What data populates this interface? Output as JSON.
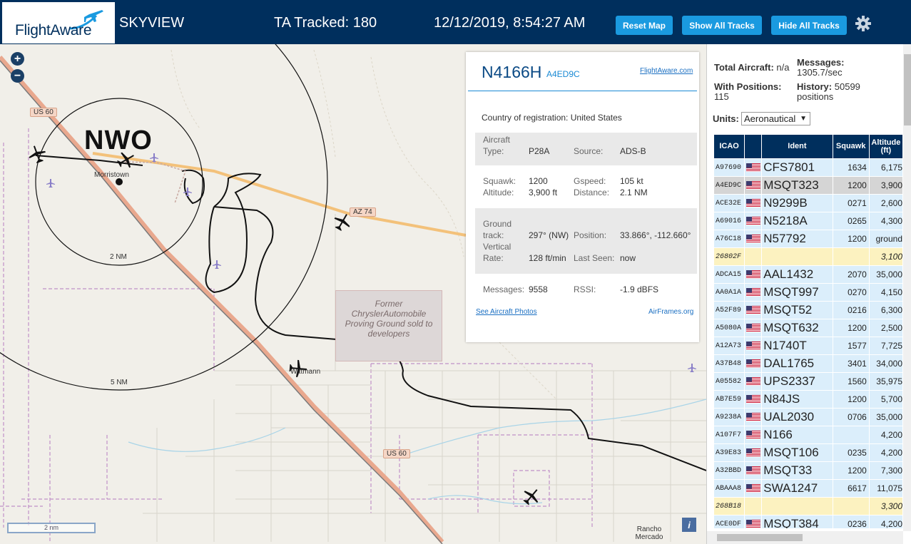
{
  "header": {
    "logo_text": "FlightAware",
    "app_name": "SKYVIEW",
    "tracked": "TA Tracked: 180",
    "datetime": "12/12/2019, 8:54:27 AM",
    "reset_map": "Reset Map",
    "show_all_tracks": "Show All Tracks",
    "hide_all_tracks": "Hide All Tracks"
  },
  "map": {
    "zoom_in": "+",
    "zoom_out": "−",
    "airport_code": "NWO",
    "labels": {
      "morristown": "Morristown",
      "wittmann": "Wittmann",
      "range_2nm": "2 NM",
      "range_5nm": "5 NM",
      "rancho": "Rancho Mercado"
    },
    "roads": {
      "us60_a": "US 60",
      "az74": "AZ 74",
      "us60_b": "US 60"
    },
    "proving_ground": "Former ChryslerAutomobile Proving Ground sold to developers",
    "scale_label": "2 nm",
    "info": "i"
  },
  "popup": {
    "callsign": "N4166H",
    "hex": "A4ED9C",
    "fa_link": "FlightAware.com",
    "country_label": "Country of registration:",
    "country": "United States",
    "aircraft_type_label": "Aircraft Type:",
    "aircraft_type": "P28A",
    "source_label": "Source:",
    "source": "ADS-B",
    "squawk_label": "Squawk:",
    "squawk": "1200",
    "gspeed_label": "Gspeed:",
    "gspeed": "105 kt",
    "altitude_label": "Altitude:",
    "altitude": "3,900 ft",
    "distance_label": "Distance:",
    "distance": "2.1 NM",
    "ground_track_label": "Ground track:",
    "ground_track": "297° (NW)",
    "position_label": "Position:",
    "position": "33.866°, -112.660°",
    "vertical_rate_label": "Vertical Rate:",
    "vertical_rate": "128 ft/min",
    "last_seen_label": "Last Seen:",
    "last_seen": "now",
    "messages_label": "Messages:",
    "messages": "9558",
    "rssi_label": "RSSI:",
    "rssi": "-1.9 dBFS",
    "photos_link": "See Aircraft Photos",
    "airframes_link": "AirFrames.org"
  },
  "panel": {
    "total_aircraft_label": "Total Aircraft:",
    "total_aircraft": "n/a",
    "messages_label": "Messages:",
    "messages": "1305.7/sec",
    "with_positions_label": "With Positions:",
    "with_positions": "115",
    "history_label": "History:",
    "history": "50599 positions",
    "units_label": "Units:",
    "units_value": "Aeronautical",
    "columns": [
      "ICAO",
      "",
      "Ident",
      "Squawk",
      "Altitude (ft)"
    ],
    "rows": [
      {
        "icao": "A97690",
        "ident": "CFS7801",
        "squawk": "1634",
        "alt": "6,175",
        "state": ""
      },
      {
        "icao": "A4ED9C",
        "ident": "MSQT323",
        "squawk": "1200",
        "alt": "3,900",
        "state": "sel"
      },
      {
        "icao": "ACE32E",
        "ident": "N9299B",
        "squawk": "0271",
        "alt": "2,600",
        "state": ""
      },
      {
        "icao": "A69016",
        "ident": "N5218A",
        "squawk": "0265",
        "alt": "4,300",
        "state": ""
      },
      {
        "icao": "A76C18",
        "ident": "N57792",
        "squawk": "1200",
        "alt": "ground",
        "state": ""
      },
      {
        "icao": "26802F",
        "ident": "",
        "squawk": "",
        "alt": "3,100",
        "state": "nopos"
      },
      {
        "icao": "ADCA15",
        "ident": "AAL1432",
        "squawk": "2070",
        "alt": "35,000",
        "state": ""
      },
      {
        "icao": "AA0A1A",
        "ident": "MSQT997",
        "squawk": "0270",
        "alt": "4,150",
        "state": ""
      },
      {
        "icao": "A52F89",
        "ident": "MSQT52",
        "squawk": "0216",
        "alt": "6,300",
        "state": ""
      },
      {
        "icao": "A5080A",
        "ident": "MSQT632",
        "squawk": "1200",
        "alt": "2,500",
        "state": ""
      },
      {
        "icao": "A12A73",
        "ident": "N1740T",
        "squawk": "1577",
        "alt": "7,725",
        "state": ""
      },
      {
        "icao": "A37B48",
        "ident": "DAL1765",
        "squawk": "3401",
        "alt": "34,000",
        "state": ""
      },
      {
        "icao": "A05582",
        "ident": "UPS2337",
        "squawk": "1560",
        "alt": "35,975",
        "state": ""
      },
      {
        "icao": "AB7E59",
        "ident": "N84JS",
        "squawk": "1200",
        "alt": "5,700",
        "state": ""
      },
      {
        "icao": "A9238A",
        "ident": "UAL2030",
        "squawk": "0706",
        "alt": "35,000",
        "state": ""
      },
      {
        "icao": "A107F7",
        "ident": "N166",
        "squawk": "",
        "alt": "4,200",
        "state": ""
      },
      {
        "icao": "A39E83",
        "ident": "MSQT106",
        "squawk": "0235",
        "alt": "4,200",
        "state": ""
      },
      {
        "icao": "A32BBD",
        "ident": "MSQT33",
        "squawk": "1200",
        "alt": "7,300",
        "state": ""
      },
      {
        "icao": "ABAAA8",
        "ident": "SWA1247",
        "squawk": "6617",
        "alt": "11,075",
        "state": ""
      },
      {
        "icao": "268B18",
        "ident": "",
        "squawk": "",
        "alt": "3,300",
        "state": "nopos"
      },
      {
        "icao": "ACE0DF",
        "ident": "MSQT384",
        "squawk": "0236",
        "alt": "4,200",
        "state": ""
      }
    ]
  },
  "colors": {
    "header_bg": "#002f5d",
    "button_bg": "#1a9ae0",
    "row_bg": "#dbeefb",
    "row_selected": "#d5d5d5",
    "row_nopos": "#fcf2c0"
  }
}
